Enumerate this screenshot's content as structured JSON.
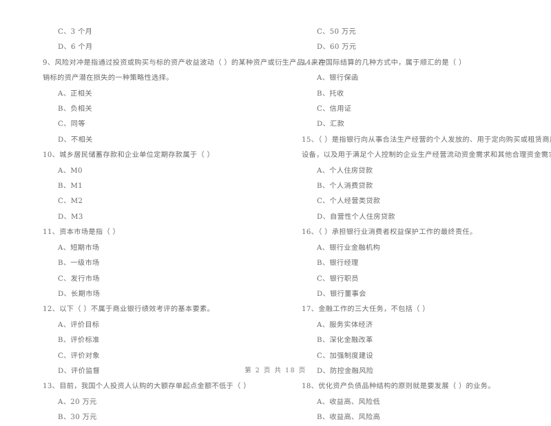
{
  "document": {
    "type": "exam-paper",
    "language": "zh-CN",
    "footer": "第 2 页 共 18 页"
  },
  "left_column": {
    "lines": [
      {
        "kind": "option",
        "text": "C、3 个月"
      },
      {
        "kind": "option",
        "text": "D、6 个月"
      },
      {
        "kind": "question",
        "text": "9、风险对冲是指通过投资或购买与标的资产收益波动（      ）的某种资产或衍生产品，来冲"
      },
      {
        "kind": "question-cont",
        "text": "销标的资产潜在损失的一种策略性选择。"
      },
      {
        "kind": "option",
        "text": "A、正相关"
      },
      {
        "kind": "option",
        "text": "B、负相关"
      },
      {
        "kind": "option",
        "text": "C、同等"
      },
      {
        "kind": "option",
        "text": "D、不相关"
      },
      {
        "kind": "question",
        "text": "10、城乡居民储蓄存款和企业单位定期存款属于（      ）"
      },
      {
        "kind": "option",
        "text": "A、M0"
      },
      {
        "kind": "option",
        "text": "B、M1"
      },
      {
        "kind": "option",
        "text": "C、M2"
      },
      {
        "kind": "option",
        "text": "D、M3"
      },
      {
        "kind": "question",
        "text": "11、资本市场是指（      ）"
      },
      {
        "kind": "option",
        "text": "A、短期市场"
      },
      {
        "kind": "option",
        "text": "B、一级市场"
      },
      {
        "kind": "option",
        "text": "C、发行市场"
      },
      {
        "kind": "option",
        "text": "D、长期市场"
      },
      {
        "kind": "question",
        "text": "12、以下（      ）不属于商业银行绩效考评的基本要素。"
      },
      {
        "kind": "option",
        "text": "A、评价目标"
      },
      {
        "kind": "option",
        "text": "B、评价标准"
      },
      {
        "kind": "option",
        "text": "C、评价对象"
      },
      {
        "kind": "option",
        "text": "D、评价监督"
      },
      {
        "kind": "question",
        "text": "13、目前，我国个人投资人认购的大额存单起点金额不低于（      ）"
      },
      {
        "kind": "option",
        "text": "A、20 万元"
      },
      {
        "kind": "option",
        "text": "B、30 万元"
      }
    ]
  },
  "right_column": {
    "lines": [
      {
        "kind": "option",
        "text": "C、50 万元"
      },
      {
        "kind": "option",
        "text": "D、60 万元"
      },
      {
        "kind": "question",
        "text": "14、在国际结算的几种方式中，属于顺汇的是（      ）"
      },
      {
        "kind": "option",
        "text": "A、银行保函"
      },
      {
        "kind": "option",
        "text": "B、托收"
      },
      {
        "kind": "option",
        "text": "C、信用证"
      },
      {
        "kind": "option",
        "text": "D、汇款"
      },
      {
        "kind": "question",
        "text": "15、（      ）是指银行向从事合法生产经营的个人发放的、用于定向购买或租赁商用房、机械"
      },
      {
        "kind": "question-cont",
        "text": "设备，以及用于满足个人控制的企业生产经营流动资金需求和其他合理资金需求的贷款。"
      },
      {
        "kind": "option",
        "text": "A、个人住房贷款"
      },
      {
        "kind": "option",
        "text": "B、个人消费贷款"
      },
      {
        "kind": "option",
        "text": "C、个人经营类贷款"
      },
      {
        "kind": "option",
        "text": "D、自营性个人住房贷款"
      },
      {
        "kind": "question",
        "text": "16、（      ）承担银行业消费者权益保护工作的最终责任。"
      },
      {
        "kind": "option",
        "text": "A、银行业金融机构"
      },
      {
        "kind": "option",
        "text": "B、银行经理"
      },
      {
        "kind": "option",
        "text": "C、银行职员"
      },
      {
        "kind": "option",
        "text": "D、银行董事会"
      },
      {
        "kind": "question",
        "text": "17、金融工作的三大任务，不包括（      ）"
      },
      {
        "kind": "option",
        "text": "A、服务实体经济"
      },
      {
        "kind": "option",
        "text": "B、深化金融改革"
      },
      {
        "kind": "option",
        "text": "C、加强制度建设"
      },
      {
        "kind": "option",
        "text": "D、防控金融风险"
      },
      {
        "kind": "question",
        "text": "18、优化资产负债品种结构的原则就是要发展（      ）的业务。"
      },
      {
        "kind": "option",
        "text": "A、收益高、风险低"
      },
      {
        "kind": "option",
        "text": "B、收益高、风险高"
      }
    ]
  }
}
